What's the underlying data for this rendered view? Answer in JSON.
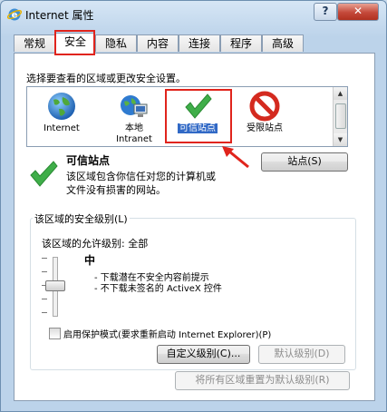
{
  "window": {
    "title": "Internet 属性",
    "help_label": "?",
    "close_label": "✕"
  },
  "tabs": [
    {
      "label": "常规"
    },
    {
      "label": "安全"
    },
    {
      "label": "隐私"
    },
    {
      "label": "内容"
    },
    {
      "label": "连接"
    },
    {
      "label": "程序"
    },
    {
      "label": "高级"
    }
  ],
  "security": {
    "instruction": "选择要查看的区域或更改安全设置。",
    "zones": [
      {
        "label": "Internet",
        "icon": "globe-icon"
      },
      {
        "label": "本地\nIntranet",
        "icon": "intranet-icon"
      },
      {
        "label": "可信站点",
        "icon": "checkmark-icon"
      },
      {
        "label": "受限站点",
        "icon": "no-entry-icon"
      }
    ],
    "selected_zone": "可信站点",
    "zone_title": "可信站点",
    "zone_desc_1": "该区域包含你信任对您的计算机或",
    "zone_desc_2": "文件没有损害的网站。",
    "sites_button": "站点(S)"
  },
  "level": {
    "group_label": "该区域的安全级别(L)",
    "allowed_label": "该区域的允许级别: 全部",
    "current": "中",
    "bullet_1": "- 下载潜在不安全内容前提示",
    "bullet_2": "- 不下载未签名的 ActiveX 控件",
    "protected_mode": "启用保护模式(要求重新启动 Internet Explorer)(P)",
    "custom_button": "自定义级别(C)...",
    "default_button": "默认级别(D)",
    "reset_all_button": "将所有区域重置为默认级别(R)"
  },
  "colors": {
    "highlight": "#e0241c",
    "selection": "#3169c6"
  }
}
